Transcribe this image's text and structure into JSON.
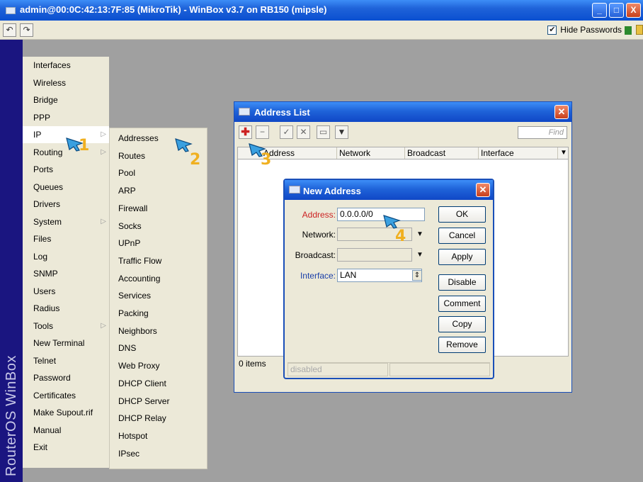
{
  "window": {
    "title": "admin@00:0C:42:13:7F:85 (MikroTik) - WinBox v3.7 on RB150 (mipsle)",
    "min": "_",
    "max": "□",
    "close": "X"
  },
  "toolbar": {
    "undo": "↶",
    "redo": "↷",
    "hide_passwords_label": "Hide Passwords",
    "hide_passwords_checked": "✔"
  },
  "brand": "RouterOS WinBox",
  "main_menu": [
    "Interfaces",
    "Wireless",
    "Bridge",
    "PPP",
    "IP",
    "Routing",
    "Ports",
    "Queues",
    "Drivers",
    "System",
    "Files",
    "Log",
    "SNMP",
    "Users",
    "Radius",
    "Tools",
    "New Terminal",
    "Telnet",
    "Password",
    "Certificates",
    "Make Supout.rif",
    "Manual",
    "Exit"
  ],
  "ip_submenu": [
    "Addresses",
    "Routes",
    "Pool",
    "ARP",
    "Firewall",
    "Socks",
    "UPnP",
    "Traffic Flow",
    "Accounting",
    "Services",
    "Packing",
    "Neighbors",
    "DNS",
    "Web Proxy",
    "DHCP Client",
    "DHCP Server",
    "DHCP Relay",
    "Hotspot",
    "IPsec"
  ],
  "address_list": {
    "title": "Address List",
    "find_placeholder": "Find",
    "columns": [
      "Address",
      "Network",
      "Broadcast",
      "Interface"
    ],
    "status": "0 items"
  },
  "new_address": {
    "title": "New Address",
    "address_label": "Address:",
    "address_value": "0.0.0.0/0",
    "network_label": "Network:",
    "broadcast_label": "Broadcast:",
    "interface_label": "Interface:",
    "interface_value": "LAN",
    "buttons": [
      "OK",
      "Cancel",
      "Apply",
      "Disable",
      "Comment",
      "Copy",
      "Remove"
    ],
    "status": "disabled"
  },
  "annotations": [
    "1",
    "2",
    "3",
    "4"
  ],
  "colors": {
    "titlebar": "#1f63d9",
    "desktop": "#a0a0a0",
    "brand": "#1a1580",
    "menu": "#ece9d8",
    "accent_red": "#cc2222",
    "annotation": "#f0b020"
  }
}
